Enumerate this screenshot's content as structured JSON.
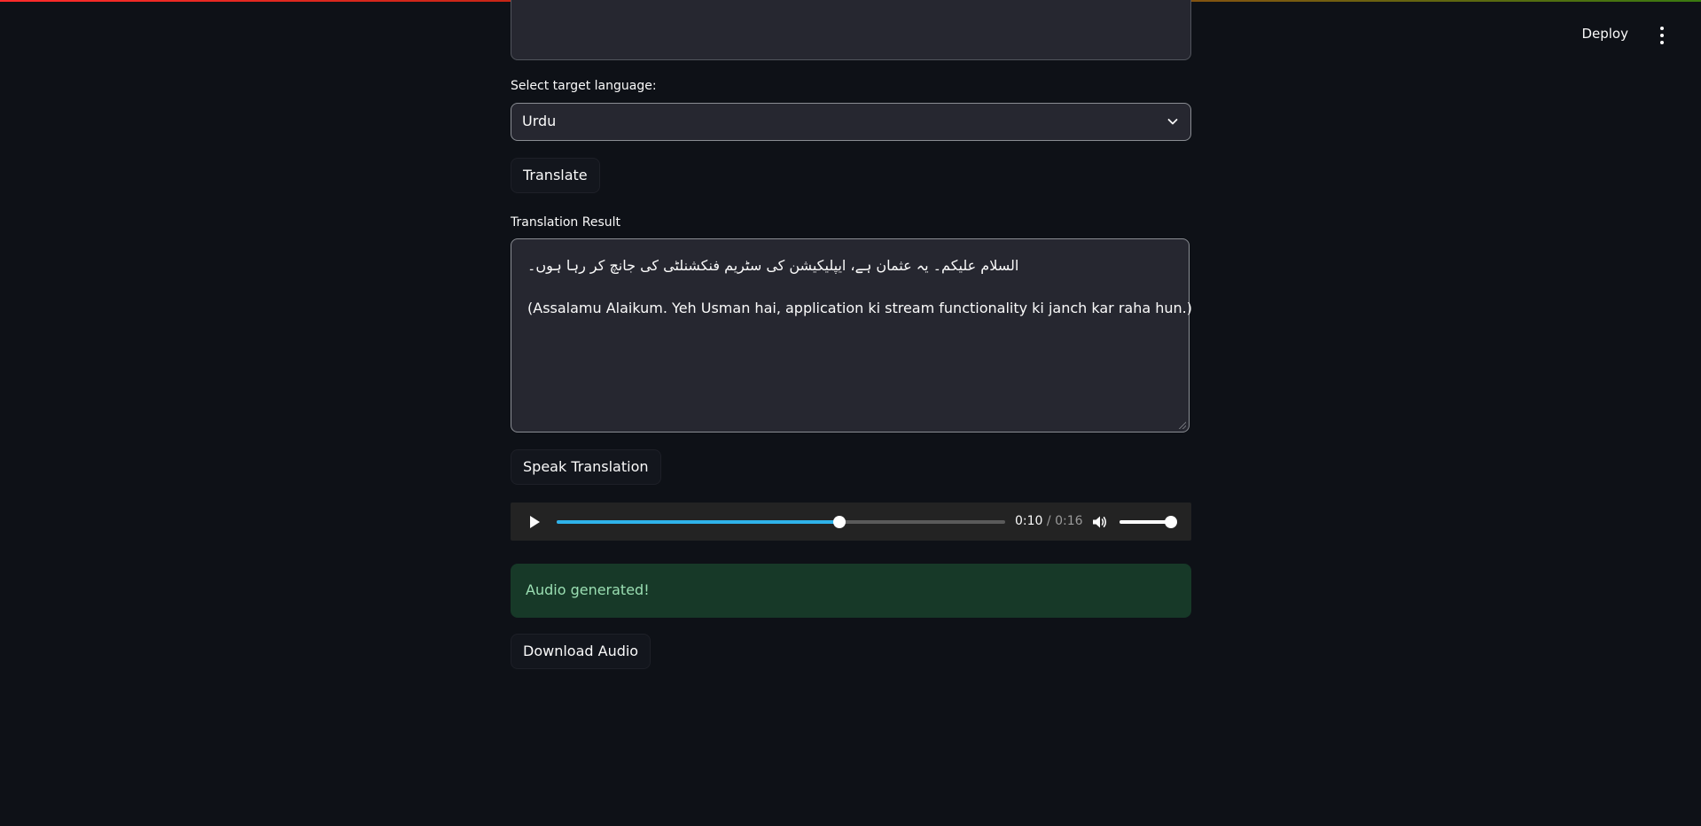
{
  "header": {
    "deploy_label": "Deploy"
  },
  "form": {
    "target_language_label": "Select target language:",
    "target_language_value": "Urdu",
    "translate_label": "Translate",
    "result_label": "Translation Result",
    "result_urdu": "السلام علیکم۔ یہ عثمان ہے، ایپلیکیشن کی سٹریم فنکشنلٹی کی جانچ کر رہا ہوں۔",
    "result_roman": "(Assalamu Alaikum. Yeh Usman hai, application ki stream functionality ki janch kar raha hun.)",
    "speak_label": "Speak Translation",
    "download_label": "Download Audio"
  },
  "audio": {
    "current_time": "0:10",
    "separator": " / ",
    "duration": "0:16",
    "progress_fraction": 0.63,
    "volume_fraction": 1.0,
    "accent_color": "#2fb3ea"
  },
  "status": {
    "message": "Audio generated!",
    "color": "#9bdfb3"
  },
  "icons": {
    "menu": "kebab-menu-icon",
    "dropdown": "chevron-down-icon",
    "play": "play-icon",
    "volume": "volume-icon"
  }
}
